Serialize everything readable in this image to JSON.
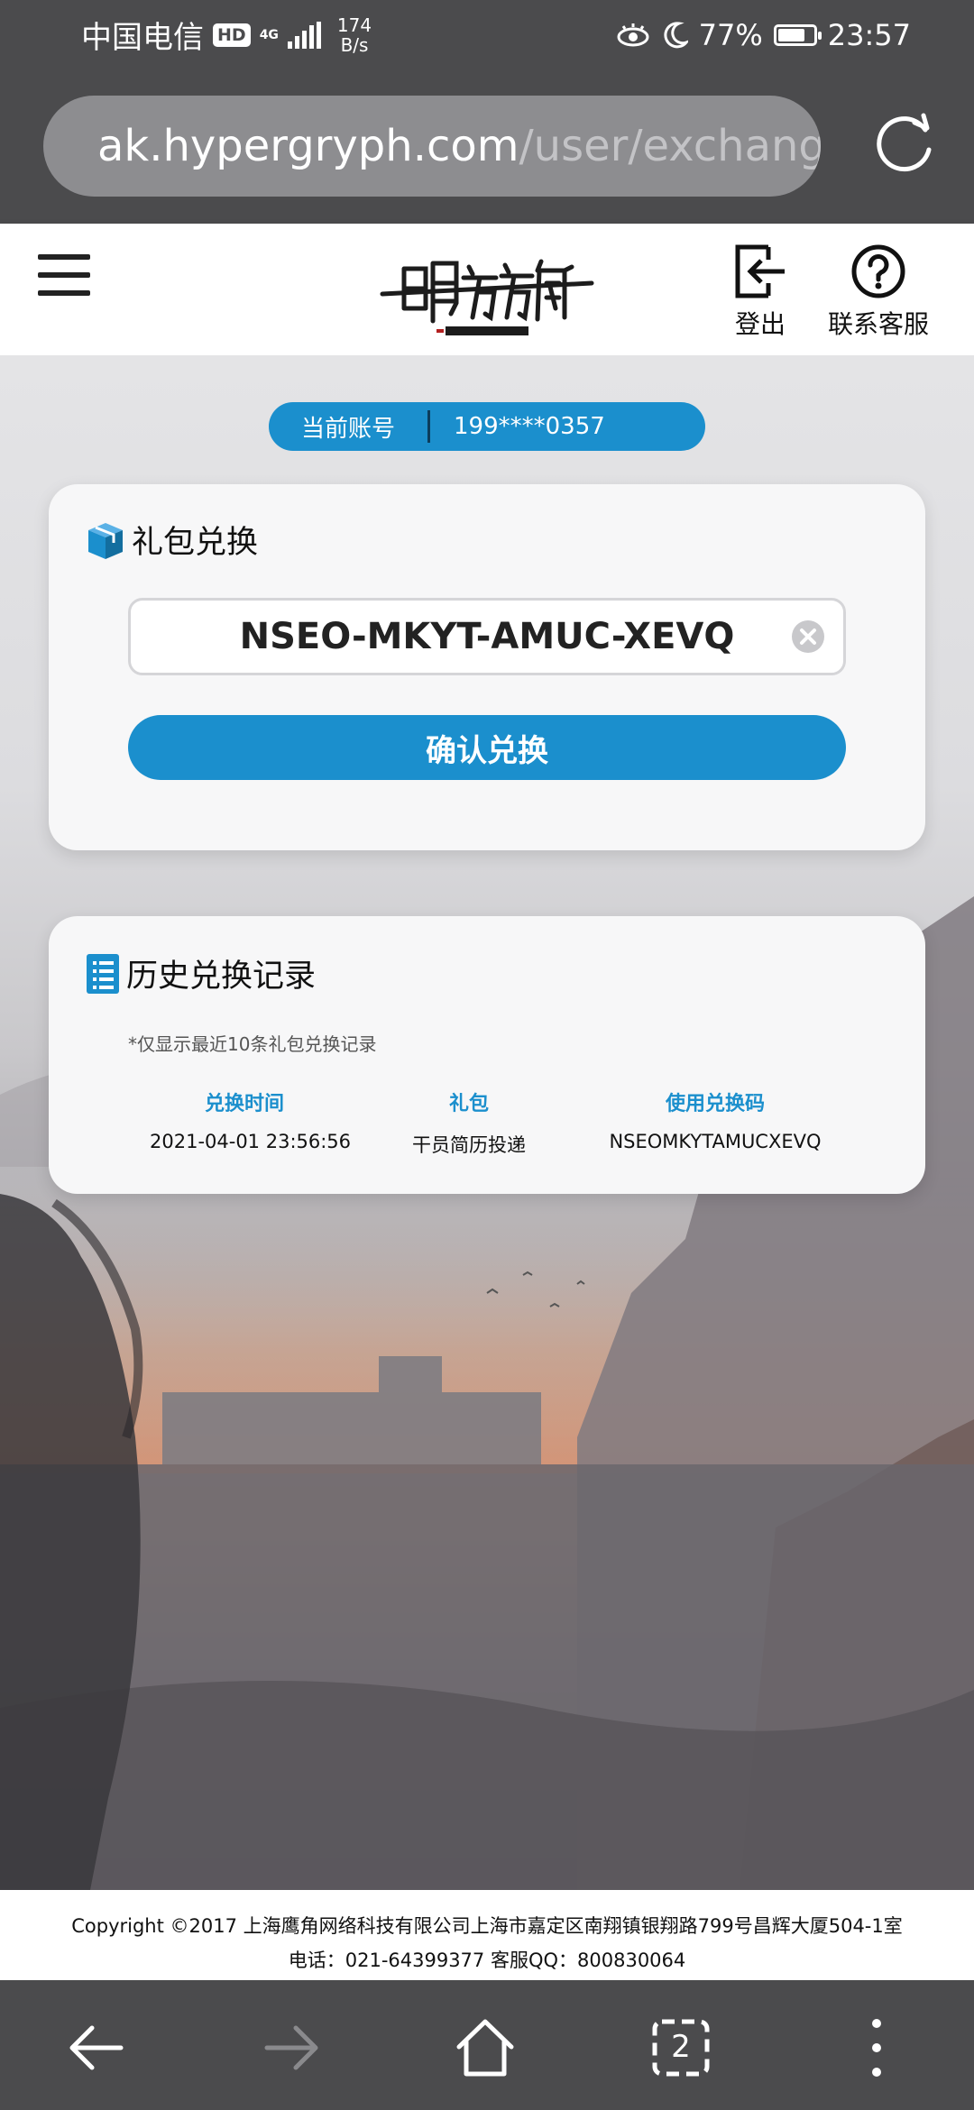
{
  "status_bar": {
    "carrier": "中国电信",
    "hd": "HD",
    "network": "4G",
    "speed_value": "174",
    "speed_unit": "B/s",
    "battery_percent": "77%",
    "battery_level": 0.77,
    "time": "23:57"
  },
  "browser": {
    "url_host": "ak.hypergryph.com",
    "url_path": "/user/exchange",
    "tab_count": "2"
  },
  "header": {
    "logo_alt": "明日方舟",
    "logout_label": "登出",
    "support_label": "联系客服"
  },
  "account": {
    "label": "当前账号",
    "value": "199****0357"
  },
  "redeem": {
    "title": "礼包兑换",
    "code_value": "NSEO-MKYT-AMUC-XEVQ",
    "confirm_label": "确认兑换"
  },
  "history": {
    "title": "历史兑换记录",
    "note": "*仅显示最近10条礼包兑换记录",
    "headers": [
      "兑换时间",
      "礼包",
      "使用兑换码"
    ],
    "rows": [
      [
        "2021-04-01 23:56:56",
        "干员简历投递",
        "NSEOMKYTAMUCXEVQ"
      ]
    ]
  },
  "footer": {
    "line1": "Copyright ©2017 上海鹰角网络科技有限公司上海市嘉定区南翔镇银翔路799号昌辉大厦504-1室",
    "line2": "电话：021-64399377 客服QQ：800830064"
  },
  "colors": {
    "accent": "#1b8fcd",
    "system_bar": "#4b4b4d",
    "warning": "#e5332a"
  },
  "icons": {
    "warning": "warning-triangle-icon",
    "reload": "reload-icon",
    "menu": "hamburger-menu-icon",
    "logout": "logout-icon",
    "support": "help-circle-icon",
    "gift": "gift-box-icon",
    "record": "document-list-icon",
    "clear": "clear-circle-icon",
    "back": "back-arrow-icon",
    "forward": "forward-arrow-icon",
    "home": "home-icon",
    "tabs": "tabs-icon",
    "more": "more-vertical-icon"
  }
}
